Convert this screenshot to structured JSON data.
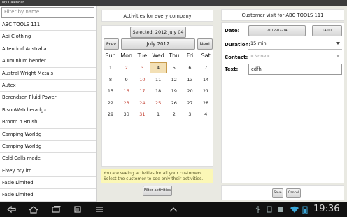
{
  "window": {
    "title": "My Calendar"
  },
  "left": {
    "filter_placeholder": "Filter by name...",
    "customers": [
      "ABC TOOLS 111",
      "Abi Clothing",
      "Altendorf Australia...",
      "Aluminium bender",
      "Austral Wright Metals",
      "Autex",
      "Berendsen Fluid Power",
      "BisonWatcheradgx",
      "Broom n Brush",
      "Camping Worldg",
      "Camping Worldg",
      "Cold Calls made",
      "Elvey pty ltd",
      "Fasie Limited",
      "Fasie Limited"
    ]
  },
  "middle": {
    "header": "Activities for every company",
    "selected_label": "Selected: 2012 July 04",
    "prev_label": "Prev",
    "month_label": "July 2012",
    "next_label": "Next",
    "weekdays": [
      "Sun",
      "Mon",
      "Tue",
      "Wed",
      "Thu",
      "Fri",
      "Sat"
    ],
    "weeks": [
      [
        "1",
        "2",
        "3",
        "4",
        "5",
        "6",
        "7"
      ],
      [
        "8",
        "9",
        "10",
        "11",
        "12",
        "13",
        "14"
      ],
      [
        "15",
        "16",
        "17",
        "18",
        "19",
        "20",
        "21"
      ],
      [
        "22",
        "23",
        "24",
        "25",
        "26",
        "27",
        "28"
      ],
      [
        "29",
        "30",
        "31",
        "1",
        "2",
        "3",
        "4"
      ]
    ],
    "info_text": "You are seeing activities for all your customers. Select the customer to see only their activities.",
    "filter_button": "Filter activities"
  },
  "right": {
    "header": "Customer visit for ABC TOOLS 111",
    "date_label": "Date:",
    "date_value": "2012-07-04",
    "time_value": "14:01",
    "duration_label": "Duration:",
    "duration_value": "15 min",
    "contact_label": "Contact:",
    "contact_value": "<None>",
    "text_label": "Text:",
    "text_value": "cdfh",
    "save_label": "Save",
    "cancel_label": "Cancel"
  },
  "navbar": {
    "time": "19:36",
    "icons": [
      "back-icon",
      "home-icon",
      "recent-apps-icon",
      "menu-icon",
      "up-icon",
      "usb-icon",
      "notification-icon",
      "wifi-icon",
      "battery-icon"
    ]
  },
  "colors": {
    "panel_bg": "#e9e9e2",
    "info_bg": "#fbf7b6",
    "weekend_red": "#c0392b",
    "selected_day": "#f3e0b5"
  }
}
